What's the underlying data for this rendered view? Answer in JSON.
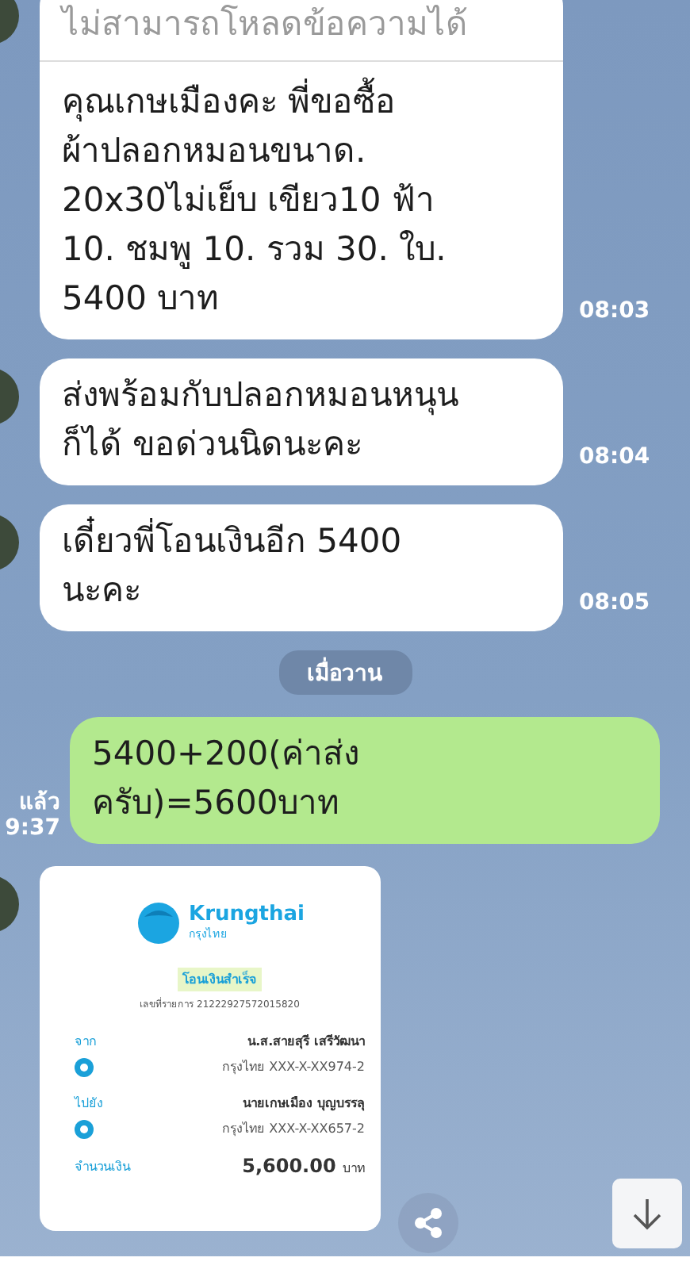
{
  "messages": [
    {
      "kind": "received",
      "notice": "ไม่สามารถโหลดข้อความได้",
      "lines": [
        "คุณเกษเมืองคะ พี่ขอซื้อ",
        "ผ้าปลอกหมอนขนาด.",
        "20x30ไม่เย็บ เขียว10 ฟ้า",
        "10.  ชมพู 10. รวม 30. ใบ.",
        "5400 บาท"
      ],
      "time": "08:03"
    },
    {
      "kind": "received",
      "lines": [
        "ส่งพร้อมกับปลอกหมอนหนุน",
        "ก็ได้ ขอด่วนนิดนะคะ"
      ],
      "time": "08:04"
    },
    {
      "kind": "received",
      "lines": [
        "เดี๋ยวพี่โอนเงินอีก 5400",
        "นะคะ"
      ],
      "time": "08:05"
    },
    {
      "kind": "date",
      "label": "เมื่อวาน"
    },
    {
      "kind": "sent",
      "lines": [
        "5400+200(ค่าส่ง",
        "ครับ)=5600บาท"
      ],
      "read": "แล้ว",
      "time": "9:37"
    },
    {
      "kind": "slip",
      "bank": "Krungthai",
      "bank_local": "กรุงไทย",
      "status": "โอนเงินสำเร็จ",
      "reference": "เลขที่รายการ 21222927572015820",
      "from_label": "จาก",
      "from_name": "น.ส.สายสุรี เสรีวัฒนา",
      "from_account": "กรุงไทย XXX-X-XX974-2",
      "to_label": "ไปยัง",
      "to_name": "นายเกษเมือง บุญบรรลุ",
      "to_account": "กรุงไทย XXX-X-XX657-2",
      "amount_label": "จำนวนเงิน",
      "amount": "5,600.00",
      "currency": "บาท"
    }
  ]
}
